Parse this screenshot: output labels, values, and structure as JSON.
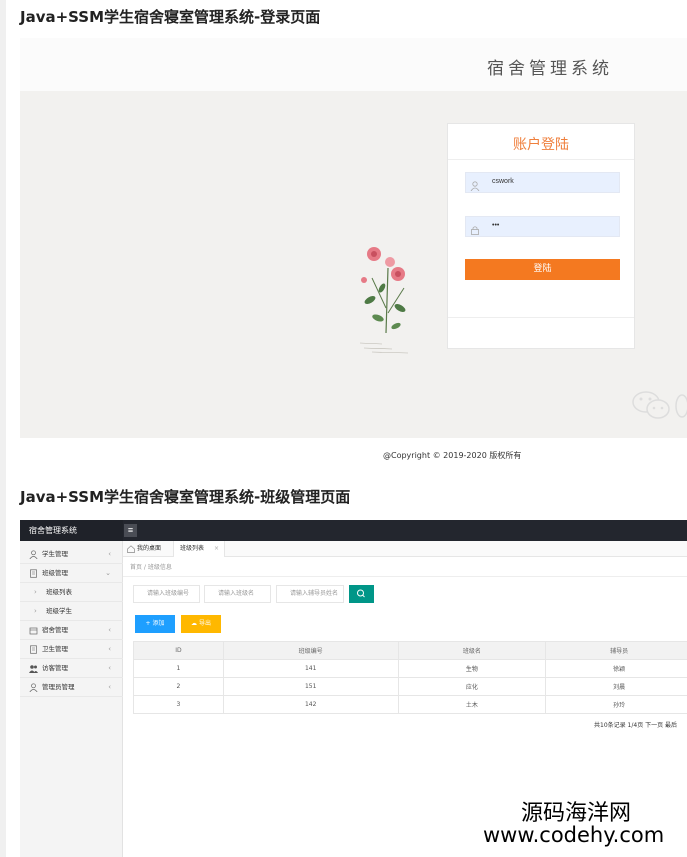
{
  "titles": {
    "login_section": "Java+SSM学生宿舍寝室管理系统-登录页面",
    "class_section": "Java+SSM学生宿舍寝室管理系统-班级管理页面"
  },
  "login": {
    "system_name": "宿舍管理系统",
    "card_title": "账户登陆",
    "username_value": "cswork",
    "password_value": "•••",
    "login_button": "登陆",
    "accent_color": "#f47920",
    "copyright": "@Copyright © 2019-2020 版权所有"
  },
  "admin": {
    "brand": "宿舍管理系统",
    "menu_icon": "hamburger-icon",
    "sidebar": [
      {
        "label": "学生管理",
        "icon": "user-icon",
        "arrow": "‹"
      },
      {
        "label": "班级管理",
        "icon": "doc-icon",
        "arrow": "⌄"
      },
      {
        "label": "班级列表",
        "sub": true
      },
      {
        "label": "班级学生",
        "sub": true
      },
      {
        "label": "宿舍管理",
        "icon": "home-icon",
        "arrow": "‹"
      },
      {
        "label": "卫生管理",
        "icon": "doc-icon",
        "arrow": "‹"
      },
      {
        "label": "访客管理",
        "icon": "users-icon",
        "arrow": "‹"
      },
      {
        "label": "管理员管理",
        "icon": "user-icon",
        "arrow": "‹"
      }
    ],
    "tabs": {
      "home": "我的桌面",
      "active": "班级列表",
      "close": "×"
    },
    "breadcrumb": "首页 / 班级信息",
    "search": {
      "class_no_placeholder": "请输入班级编号",
      "class_name_placeholder": "请输入班级名",
      "counselor_placeholder": "请输入辅导员姓名"
    },
    "buttons": {
      "add": "+ 添加",
      "export": "导出"
    },
    "table": {
      "headers": [
        "ID",
        "班级编号",
        "班级名",
        "辅导员"
      ],
      "rows": [
        [
          "1",
          "141",
          "生物",
          "徐颖"
        ],
        [
          "2",
          "151",
          "应化",
          "刘晨"
        ],
        [
          "3",
          "142",
          "土木",
          "孙玲"
        ]
      ]
    },
    "pager": "共10条记录 1/4页 下一页 最后",
    "colors": {
      "topbar": "#23262e",
      "search_btn": "#009688",
      "add_btn": "#1e9fff",
      "export_btn": "#ffb800"
    }
  },
  "watermark": {
    "name": "源码海洋网",
    "url": "www.codehy.com"
  }
}
